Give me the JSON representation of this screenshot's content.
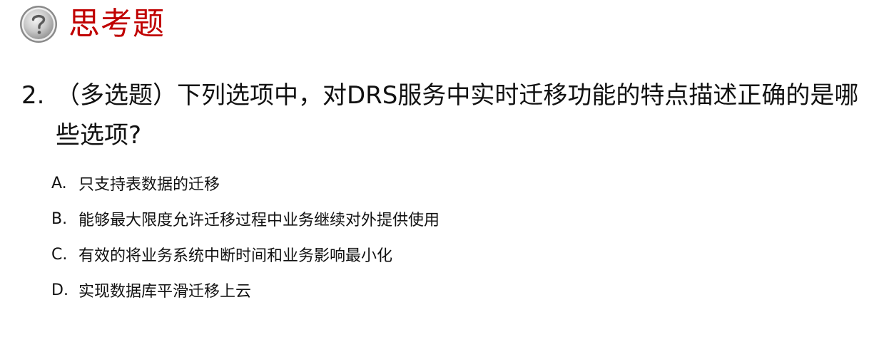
{
  "colors": {
    "title": "#c00000",
    "text": "#111111",
    "icon_fill": "#c8c8c8",
    "icon_ring": "#8a8a8a"
  },
  "header": {
    "icon": "question-mark-icon",
    "title": "思考题"
  },
  "question": {
    "number": "2.",
    "text": "（多选题）下列选项中，对DRS服务中实时迁移功能的特点描述正确的是哪些选项?"
  },
  "options": [
    {
      "letter": "A.",
      "text": "只支持表数据的迁移"
    },
    {
      "letter": "B.",
      "text": "能够最大限度允许迁移过程中业务继续对外提供使用"
    },
    {
      "letter": "C.",
      "text": "有效的将业务系统中断时间和业务影响最小化"
    },
    {
      "letter": "D.",
      "text": "实现数据库平滑迁移上云"
    }
  ]
}
